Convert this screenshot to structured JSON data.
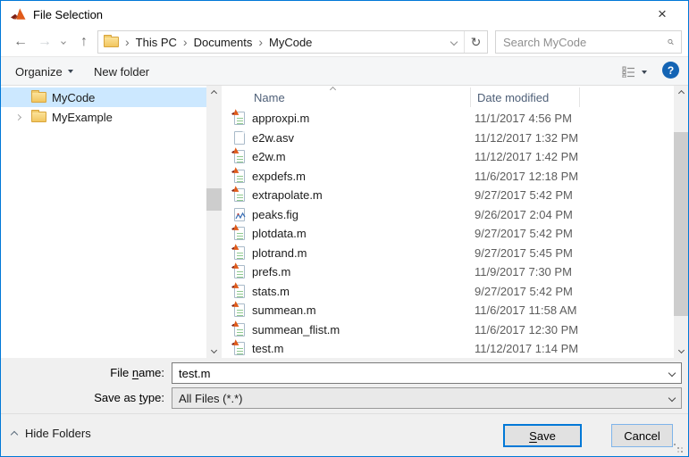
{
  "window": {
    "title": "File Selection",
    "accent_color": "#0078d7"
  },
  "icons": {
    "close": "×",
    "back": "←",
    "forward": "→",
    "up": "↑",
    "refresh": "↻",
    "breadcrumb_separator": "›",
    "help": "?"
  },
  "navbar": {
    "breadcrumb": {
      "segments": [
        "This PC",
        "Documents",
        "MyCode"
      ]
    },
    "search_placeholder": "Search MyCode"
  },
  "toolbar": {
    "organize_label": "Organize",
    "new_folder_label": "New folder"
  },
  "sidebar": {
    "items": [
      {
        "label": "MyCode",
        "selected": true
      },
      {
        "label": "MyExample",
        "selected": false,
        "expandable": true
      }
    ]
  },
  "filelist": {
    "columns": {
      "name": "Name",
      "date_modified": "Date modified"
    },
    "items": [
      {
        "name": "approxpi.m",
        "modified": "11/1/2017 4:56 PM",
        "icon": "matlab"
      },
      {
        "name": "e2w.asv",
        "modified": "11/12/2017 1:32 PM",
        "icon": "plain"
      },
      {
        "name": "e2w.m",
        "modified": "11/12/2017 1:42 PM",
        "icon": "matlab"
      },
      {
        "name": "expdefs.m",
        "modified": "11/6/2017 12:18 PM",
        "icon": "matlab"
      },
      {
        "name": "extrapolate.m",
        "modified": "9/27/2017 5:42 PM",
        "icon": "matlab"
      },
      {
        "name": "peaks.fig",
        "modified": "9/26/2017 2:04 PM",
        "icon": "figure"
      },
      {
        "name": "plotdata.m",
        "modified": "9/27/2017 5:42 PM",
        "icon": "matlab"
      },
      {
        "name": "plotrand.m",
        "modified": "9/27/2017 5:45 PM",
        "icon": "matlab"
      },
      {
        "name": "prefs.m",
        "modified": "11/9/2017 7:30 PM",
        "icon": "matlab"
      },
      {
        "name": "stats.m",
        "modified": "9/27/2017 5:42 PM",
        "icon": "matlab"
      },
      {
        "name": "summean.m",
        "modified": "11/6/2017 11:58 AM",
        "icon": "matlab"
      },
      {
        "name": "summean_flist.m",
        "modified": "11/6/2017 12:30 PM",
        "icon": "matlab"
      },
      {
        "name": "test.m",
        "modified": "11/12/2017 1:14 PM",
        "icon": "matlab"
      }
    ]
  },
  "fields": {
    "file_name": {
      "label_pre": "File ",
      "label_mnemonic": "n",
      "label_post": "ame:",
      "value": "test.m"
    },
    "save_as_type": {
      "label_pre": "Save as ",
      "label_mnemonic": "t",
      "label_post": "ype:",
      "value": "All Files (*.*)"
    }
  },
  "footer": {
    "hide_folders_label": "Hide Folders",
    "save_pre": "",
    "save_mnemonic": "S",
    "save_post": "ave",
    "cancel_label": "Cancel"
  }
}
